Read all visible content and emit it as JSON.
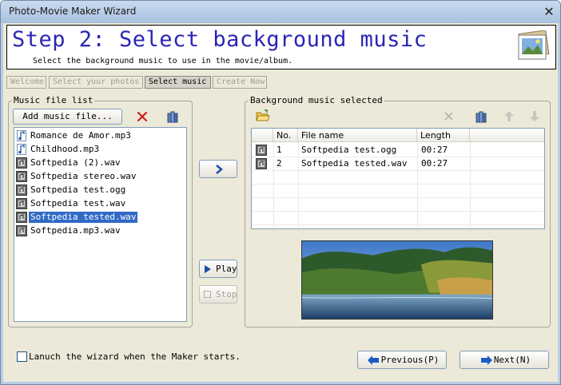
{
  "window": {
    "title": "Photo-Movie Maker Wizard",
    "close_glyph": "✕"
  },
  "header": {
    "title": "Step 2: Select background music",
    "subtitle": "Select the background music to use in the movie/album.",
    "icon": "photo-album-icon"
  },
  "wizard_tabs": [
    {
      "label": "Welcome",
      "active": false
    },
    {
      "label": "Select your photos",
      "active": false
    },
    {
      "label": "Select music",
      "active": true
    },
    {
      "label": "Create Now",
      "active": false
    }
  ],
  "left_panel": {
    "group_label": "Music file list",
    "add_button_label": "Add music file...",
    "remove_icon": "red-x-icon",
    "library_icon": "library-icon",
    "files": [
      {
        "name": "Romance de Amor.mp3",
        "type": "mp3",
        "selected": false
      },
      {
        "name": "Childhood.mp3",
        "type": "mp3",
        "selected": false
      },
      {
        "name": "Softpedia (2).wav",
        "type": "wav",
        "selected": false
      },
      {
        "name": "Softpedia stereo.wav",
        "type": "wav",
        "selected": false
      },
      {
        "name": "Softpedia test.ogg",
        "type": "ogg",
        "selected": false
      },
      {
        "name": "Softpedia test.wav",
        "type": "wav",
        "selected": false
      },
      {
        "name": "Softpedia tested.wav",
        "type": "wav",
        "selected": true
      },
      {
        "name": "Softpedia.mp3.wav",
        "type": "wav",
        "selected": false
      }
    ]
  },
  "middle": {
    "add_arrow_glyph": "❯",
    "play_label": "Play",
    "stop_label": "Stop"
  },
  "right_panel": {
    "group_label": "Background music selected",
    "columns": [
      "No.",
      "File name",
      "Length"
    ],
    "rows": [
      {
        "no": "1",
        "file": "Softpedia test.ogg",
        "length": "00:27"
      },
      {
        "no": "2",
        "file": "Softpedia tested.wav",
        "length": "00:27"
      }
    ]
  },
  "footer": {
    "launch_checkbox_label": "Lanuch the wizard when the Maker starts.",
    "launch_checked": false,
    "previous_label": "Previous(P)",
    "next_label": "Next(N)"
  },
  "colors": {
    "title_blue": "#2a25b5",
    "selection": "#316ac5",
    "face": "#ece9d8"
  }
}
